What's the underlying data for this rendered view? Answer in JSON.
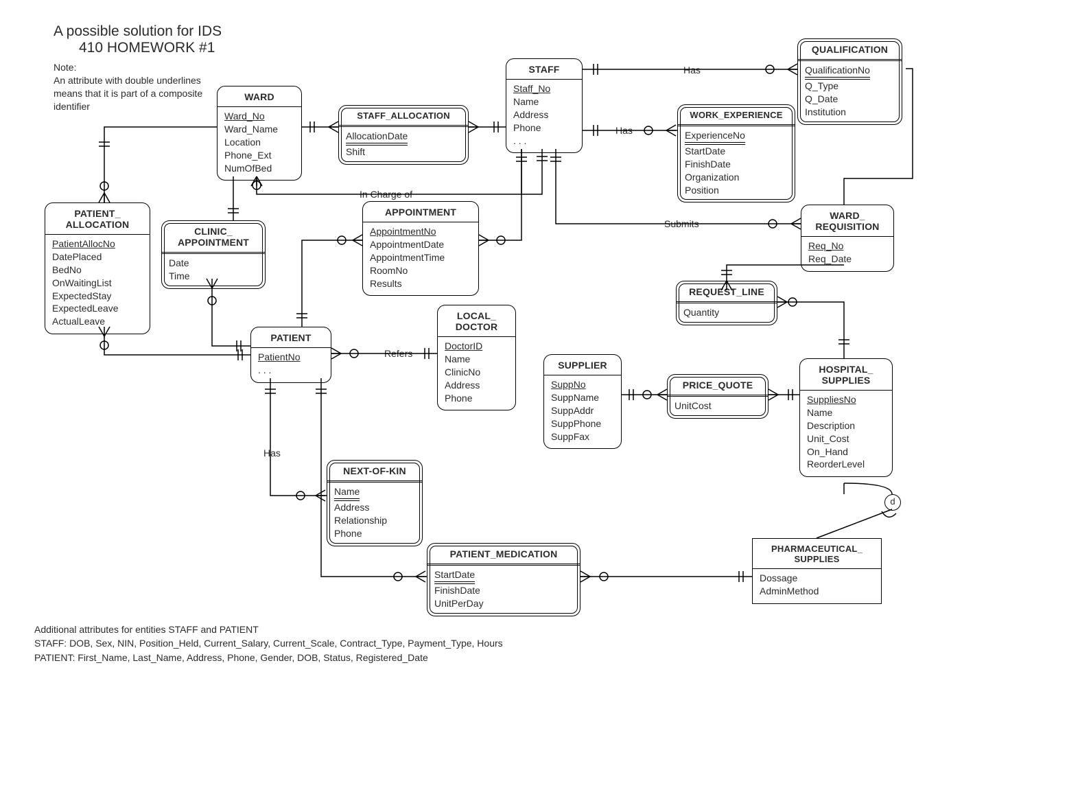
{
  "title_l1": "A possible solution for IDS",
  "title_l2": "410 HOMEWORK #1",
  "note_hdr": "Note:",
  "note_body": "An attribute with double underlines  means that it is part of a composite identifier",
  "footer_hdr": "Additional attributes for entities STAFF and PATIENT",
  "footer_staff": "STAFF: DOB, Sex, NIN, Position_Held, Current_Salary, Current_Scale, Contract_Type, Payment_Type, Hours",
  "footer_patient": "PATIENT: First_Name, Last_Name, Address, Phone, Gender, DOB, Status, Registered_Date",
  "entities": {
    "ward": {
      "title": "WARD",
      "pk": "Ward_No",
      "attrs": [
        "Ward_Name",
        "Location",
        "Phone_Ext",
        "NumOfBed"
      ]
    },
    "staff": {
      "title": "STAFF",
      "pk": "Staff_No",
      "attrs": [
        "Name",
        "Address",
        "Phone",
        ". . ."
      ]
    },
    "qualification": {
      "title": "QUALIFICATION",
      "pk": "QualificationNo",
      "attrs": [
        "Q_Type",
        "Q_Date",
        "Institution"
      ]
    },
    "workexp": {
      "title": "WORK_EXPERIENCE",
      "pk": "ExperienceNo",
      "attrs": [
        "StartDate",
        "FinishDate",
        "Organization",
        "Position"
      ]
    },
    "staff_alloc": {
      "title": "STAFF_ALLOCATION",
      "pk": "AllocationDate",
      "attrs": [
        "Shift"
      ]
    },
    "patient_alloc": {
      "title_l1": "PATIENT_",
      "title_l2": "ALLOCATION",
      "pk": "PatientAllocNo",
      "attrs": [
        "DatePlaced",
        "BedNo",
        "OnWaitingList",
        "ExpectedStay",
        "ExpectedLeave",
        "ActualLeave"
      ]
    },
    "clinic_appt": {
      "title_l1": "CLINIC_",
      "title_l2": "APPOINTMENT",
      "attrs": [
        "Date",
        "Time"
      ]
    },
    "appointment": {
      "title": "APPOINTMENT",
      "pk": "AppointmentNo",
      "attrs": [
        "AppointmentDate",
        "AppointmentTime",
        "RoomNo",
        "Results"
      ]
    },
    "ward_req": {
      "title_l1": "WARD_",
      "title_l2": "REQUISITION",
      "pk": "Req_No",
      "attrs": [
        "Req_Date"
      ]
    },
    "request_line": {
      "title": "REQUEST_LINE",
      "attrs": [
        "Quantity"
      ]
    },
    "patient": {
      "title": "PATIENT",
      "pk": "PatientNo",
      "attrs": [
        ". . ."
      ]
    },
    "local_doctor": {
      "title_l1": "LOCAL_",
      "title_l2": "DOCTOR",
      "pk": "DoctorID",
      "attrs": [
        "Name",
        "ClinicNo",
        "Address",
        "Phone"
      ]
    },
    "supplier": {
      "title": "SUPPLIER",
      "pk": "SuppNo",
      "attrs": [
        "SuppName",
        "SuppAddr",
        "SuppPhone",
        "SuppFax"
      ]
    },
    "price_quote": {
      "title": "PRICE_QUOTE",
      "attrs": [
        "UnitCost"
      ]
    },
    "supplies": {
      "title_l1": "HOSPITAL_",
      "title_l2": "SUPPLIES",
      "pk": "SuppliesNo",
      "attrs": [
        "Name",
        "Description",
        "Unit_Cost",
        "On_Hand",
        "ReorderLevel"
      ]
    },
    "next_of_kin": {
      "title": "NEXT-OF-KIN",
      "pk": "Name",
      "attrs": [
        "Address",
        "Relationship",
        "Phone"
      ]
    },
    "patient_med": {
      "title": "PATIENT_MEDICATION",
      "pk": "StartDate",
      "attrs": [
        "FinishDate",
        "UnitPerDay"
      ]
    },
    "pharm": {
      "title_l1": "PHARMACEUTICAL_",
      "title_l2": "SUPPLIES",
      "attrs": [
        "Dossage",
        "AdminMethod"
      ]
    }
  },
  "rels": {
    "has1": "Has",
    "has2": "Has",
    "has3": "Has",
    "submits": "Submits",
    "incharge": "In Charge of",
    "refers": "Refers",
    "d": "d"
  },
  "chart_data": {
    "type": "er-diagram",
    "entities": [
      {
        "name": "WARD",
        "weak": false,
        "identifier": [
          "Ward_No"
        ],
        "attrs": [
          "Ward_Name",
          "Location",
          "Phone_Ext",
          "NumOfBed"
        ]
      },
      {
        "name": "STAFF",
        "weak": false,
        "identifier": [
          "Staff_No"
        ],
        "attrs": [
          "Name",
          "Address",
          "Phone",
          "…"
        ]
      },
      {
        "name": "QUALIFICATION",
        "weak": true,
        "identifier": [
          "QualificationNo"
        ],
        "attrs": [
          "Q_Type",
          "Q_Date",
          "Institution"
        ]
      },
      {
        "name": "WORK_EXPERIENCE",
        "weak": true,
        "identifier": [
          "ExperienceNo"
        ],
        "attrs": [
          "StartDate",
          "FinishDate",
          "Organization",
          "Position"
        ]
      },
      {
        "name": "STAFF_ALLOCATION",
        "weak": true,
        "identifier": [
          "AllocationDate"
        ],
        "attrs": [
          "Shift"
        ],
        "associative": true
      },
      {
        "name": "PATIENT_ALLOCATION",
        "weak": false,
        "identifier": [
          "PatientAllocNo"
        ],
        "attrs": [
          "DatePlaced",
          "BedNo",
          "OnWaitingList",
          "ExpectedStay",
          "ExpectedLeave",
          "ActualLeave"
        ],
        "associative": true
      },
      {
        "name": "CLINIC_APPOINTMENT",
        "weak": true,
        "identifier": [],
        "attrs": [
          "Date",
          "Time"
        ],
        "associative": true
      },
      {
        "name": "APPOINTMENT",
        "weak": false,
        "identifier": [
          "AppointmentNo"
        ],
        "attrs": [
          "AppointmentDate",
          "AppointmentTime",
          "RoomNo",
          "Results"
        ],
        "associative": true
      },
      {
        "name": "WARD_REQUISITION",
        "weak": false,
        "identifier": [
          "Req_No"
        ],
        "attrs": [
          "Req_Date"
        ],
        "associative": true
      },
      {
        "name": "REQUEST_LINE",
        "weak": true,
        "identifier": [],
        "attrs": [
          "Quantity"
        ],
        "associative": true
      },
      {
        "name": "PATIENT",
        "weak": false,
        "identifier": [
          "PatientNo"
        ],
        "attrs": [
          "…"
        ]
      },
      {
        "name": "LOCAL_DOCTOR",
        "weak": false,
        "identifier": [
          "DoctorID"
        ],
        "attrs": [
          "Name",
          "ClinicNo",
          "Address",
          "Phone"
        ]
      },
      {
        "name": "SUPPLIER",
        "weak": false,
        "identifier": [
          "SuppNo"
        ],
        "attrs": [
          "SuppName",
          "SuppAddr",
          "SuppPhone",
          "SuppFax"
        ]
      },
      {
        "name": "PRICE_QUOTE",
        "weak": true,
        "identifier": [],
        "attrs": [
          "UnitCost"
        ],
        "associative": true
      },
      {
        "name": "HOSPITAL_SUPPLIES",
        "weak": false,
        "identifier": [
          "SuppliesNo"
        ],
        "attrs": [
          "Name",
          "Description",
          "Unit_Cost",
          "On_Hand",
          "ReorderLevel"
        ]
      },
      {
        "name": "NEXT-OF-KIN",
        "weak": true,
        "identifier": [
          "Name"
        ],
        "attrs": [
          "Address",
          "Relationship",
          "Phone"
        ]
      },
      {
        "name": "PATIENT_MEDICATION",
        "weak": true,
        "identifier": [
          "StartDate"
        ],
        "attrs": [
          "FinishDate",
          "UnitPerDay"
        ],
        "associative": true
      },
      {
        "name": "PHARMACEUTICAL_SUPPLIES",
        "weak": false,
        "identifier": [],
        "attrs": [
          "Dossage",
          "AdminMethod"
        ],
        "subtype_of": "HOSPITAL_SUPPLIES"
      }
    ],
    "relationships": [
      {
        "label": "Has",
        "between": [
          "STAFF",
          "QUALIFICATION"
        ],
        "cardinality": [
          "1..1",
          "0..N"
        ]
      },
      {
        "label": "Has",
        "between": [
          "STAFF",
          "WORK_EXPERIENCE"
        ],
        "cardinality": [
          "1..1",
          "0..N"
        ]
      },
      {
        "label": "",
        "between": [
          "WARD",
          "STAFF_ALLOCATION",
          "STAFF"
        ],
        "associative": "STAFF_ALLOCATION"
      },
      {
        "label": "In Charge of",
        "between": [
          "WARD",
          "STAFF"
        ],
        "cardinality": [
          "0..N",
          "1..1"
        ]
      },
      {
        "label": "",
        "between": [
          "WARD",
          "PATIENT_ALLOCATION",
          "PATIENT"
        ],
        "associative": "PATIENT_ALLOCATION"
      },
      {
        "label": "",
        "between": [
          "STAFF",
          "CLINIC_APPOINTMENT",
          "PATIENT"
        ],
        "associative": "CLINIC_APPOINTMENT"
      },
      {
        "label": "",
        "between": [
          "STAFF",
          "APPOINTMENT",
          "PATIENT"
        ],
        "associative": "APPOINTMENT"
      },
      {
        "label": "Submits",
        "between": [
          "STAFF",
          "WARD_REQUISITION"
        ],
        "cardinality": [
          "1..1",
          "0..N"
        ]
      },
      {
        "label": "",
        "between": [
          "WARD",
          "WARD_REQUISITION"
        ],
        "cardinality": [
          "1..1",
          "0..N"
        ]
      },
      {
        "label": "",
        "between": [
          "WARD_REQUISITION",
          "REQUEST_LINE",
          "HOSPITAL_SUPPLIES"
        ],
        "associative": "REQUEST_LINE"
      },
      {
        "label": "Refers",
        "between": [
          "PATIENT",
          "LOCAL_DOCTOR"
        ],
        "cardinality": [
          "0..N",
          "1..1"
        ]
      },
      {
        "label": "Has",
        "between": [
          "PATIENT",
          "NEXT-OF-KIN"
        ],
        "cardinality": [
          "1..1",
          "0..N"
        ]
      },
      {
        "label": "",
        "between": [
          "SUPPLIER",
          "PRICE_QUOTE",
          "HOSPITAL_SUPPLIES"
        ],
        "associative": "PRICE_QUOTE"
      },
      {
        "label": "",
        "between": [
          "PATIENT",
          "PATIENT_MEDICATION",
          "PHARMACEUTICAL_SUPPLIES"
        ],
        "associative": "PATIENT_MEDICATION"
      },
      {
        "label": "d",
        "between": [
          "HOSPITAL_SUPPLIES",
          "PHARMACEUTICAL_SUPPLIES"
        ],
        "type": "subtype-disjoint"
      }
    ]
  }
}
